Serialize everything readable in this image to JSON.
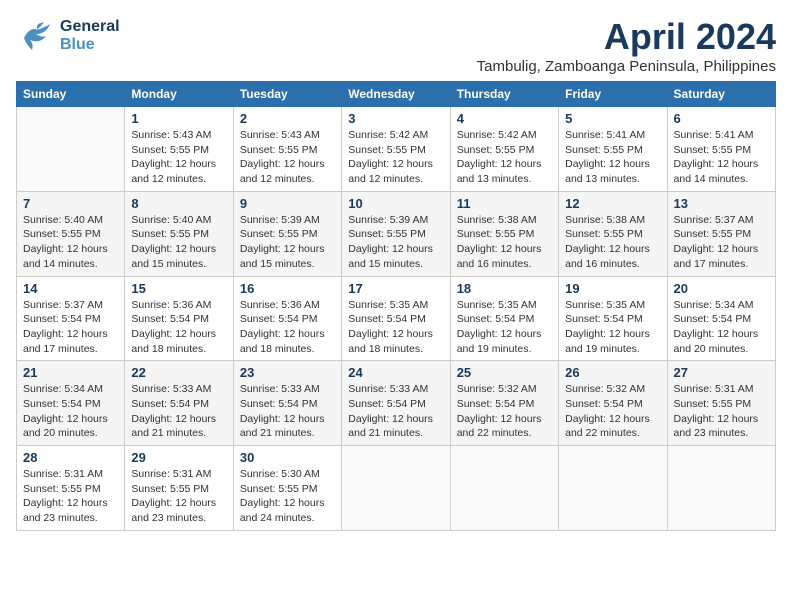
{
  "header": {
    "logo_general": "General",
    "logo_blue": "Blue",
    "month_title": "April 2024",
    "subtitle": "Tambulig, Zamboanga Peninsula, Philippines"
  },
  "days_of_week": [
    "Sunday",
    "Monday",
    "Tuesday",
    "Wednesday",
    "Thursday",
    "Friday",
    "Saturday"
  ],
  "weeks": [
    [
      {
        "num": "",
        "info": ""
      },
      {
        "num": "1",
        "info": "Sunrise: 5:43 AM\nSunset: 5:55 PM\nDaylight: 12 hours\nand 12 minutes."
      },
      {
        "num": "2",
        "info": "Sunrise: 5:43 AM\nSunset: 5:55 PM\nDaylight: 12 hours\nand 12 minutes."
      },
      {
        "num": "3",
        "info": "Sunrise: 5:42 AM\nSunset: 5:55 PM\nDaylight: 12 hours\nand 12 minutes."
      },
      {
        "num": "4",
        "info": "Sunrise: 5:42 AM\nSunset: 5:55 PM\nDaylight: 12 hours\nand 13 minutes."
      },
      {
        "num": "5",
        "info": "Sunrise: 5:41 AM\nSunset: 5:55 PM\nDaylight: 12 hours\nand 13 minutes."
      },
      {
        "num": "6",
        "info": "Sunrise: 5:41 AM\nSunset: 5:55 PM\nDaylight: 12 hours\nand 14 minutes."
      }
    ],
    [
      {
        "num": "7",
        "info": "Sunrise: 5:40 AM\nSunset: 5:55 PM\nDaylight: 12 hours\nand 14 minutes."
      },
      {
        "num": "8",
        "info": "Sunrise: 5:40 AM\nSunset: 5:55 PM\nDaylight: 12 hours\nand 15 minutes."
      },
      {
        "num": "9",
        "info": "Sunrise: 5:39 AM\nSunset: 5:55 PM\nDaylight: 12 hours\nand 15 minutes."
      },
      {
        "num": "10",
        "info": "Sunrise: 5:39 AM\nSunset: 5:55 PM\nDaylight: 12 hours\nand 15 minutes."
      },
      {
        "num": "11",
        "info": "Sunrise: 5:38 AM\nSunset: 5:55 PM\nDaylight: 12 hours\nand 16 minutes."
      },
      {
        "num": "12",
        "info": "Sunrise: 5:38 AM\nSunset: 5:55 PM\nDaylight: 12 hours\nand 16 minutes."
      },
      {
        "num": "13",
        "info": "Sunrise: 5:37 AM\nSunset: 5:55 PM\nDaylight: 12 hours\nand 17 minutes."
      }
    ],
    [
      {
        "num": "14",
        "info": "Sunrise: 5:37 AM\nSunset: 5:54 PM\nDaylight: 12 hours\nand 17 minutes."
      },
      {
        "num": "15",
        "info": "Sunrise: 5:36 AM\nSunset: 5:54 PM\nDaylight: 12 hours\nand 18 minutes."
      },
      {
        "num": "16",
        "info": "Sunrise: 5:36 AM\nSunset: 5:54 PM\nDaylight: 12 hours\nand 18 minutes."
      },
      {
        "num": "17",
        "info": "Sunrise: 5:35 AM\nSunset: 5:54 PM\nDaylight: 12 hours\nand 18 minutes."
      },
      {
        "num": "18",
        "info": "Sunrise: 5:35 AM\nSunset: 5:54 PM\nDaylight: 12 hours\nand 19 minutes."
      },
      {
        "num": "19",
        "info": "Sunrise: 5:35 AM\nSunset: 5:54 PM\nDaylight: 12 hours\nand 19 minutes."
      },
      {
        "num": "20",
        "info": "Sunrise: 5:34 AM\nSunset: 5:54 PM\nDaylight: 12 hours\nand 20 minutes."
      }
    ],
    [
      {
        "num": "21",
        "info": "Sunrise: 5:34 AM\nSunset: 5:54 PM\nDaylight: 12 hours\nand 20 minutes."
      },
      {
        "num": "22",
        "info": "Sunrise: 5:33 AM\nSunset: 5:54 PM\nDaylight: 12 hours\nand 21 minutes."
      },
      {
        "num": "23",
        "info": "Sunrise: 5:33 AM\nSunset: 5:54 PM\nDaylight: 12 hours\nand 21 minutes."
      },
      {
        "num": "24",
        "info": "Sunrise: 5:33 AM\nSunset: 5:54 PM\nDaylight: 12 hours\nand 21 minutes."
      },
      {
        "num": "25",
        "info": "Sunrise: 5:32 AM\nSunset: 5:54 PM\nDaylight: 12 hours\nand 22 minutes."
      },
      {
        "num": "26",
        "info": "Sunrise: 5:32 AM\nSunset: 5:54 PM\nDaylight: 12 hours\nand 22 minutes."
      },
      {
        "num": "27",
        "info": "Sunrise: 5:31 AM\nSunset: 5:55 PM\nDaylight: 12 hours\nand 23 minutes."
      }
    ],
    [
      {
        "num": "28",
        "info": "Sunrise: 5:31 AM\nSunset: 5:55 PM\nDaylight: 12 hours\nand 23 minutes."
      },
      {
        "num": "29",
        "info": "Sunrise: 5:31 AM\nSunset: 5:55 PM\nDaylight: 12 hours\nand 23 minutes."
      },
      {
        "num": "30",
        "info": "Sunrise: 5:30 AM\nSunset: 5:55 PM\nDaylight: 12 hours\nand 24 minutes."
      },
      {
        "num": "",
        "info": ""
      },
      {
        "num": "",
        "info": ""
      },
      {
        "num": "",
        "info": ""
      },
      {
        "num": "",
        "info": ""
      }
    ]
  ]
}
